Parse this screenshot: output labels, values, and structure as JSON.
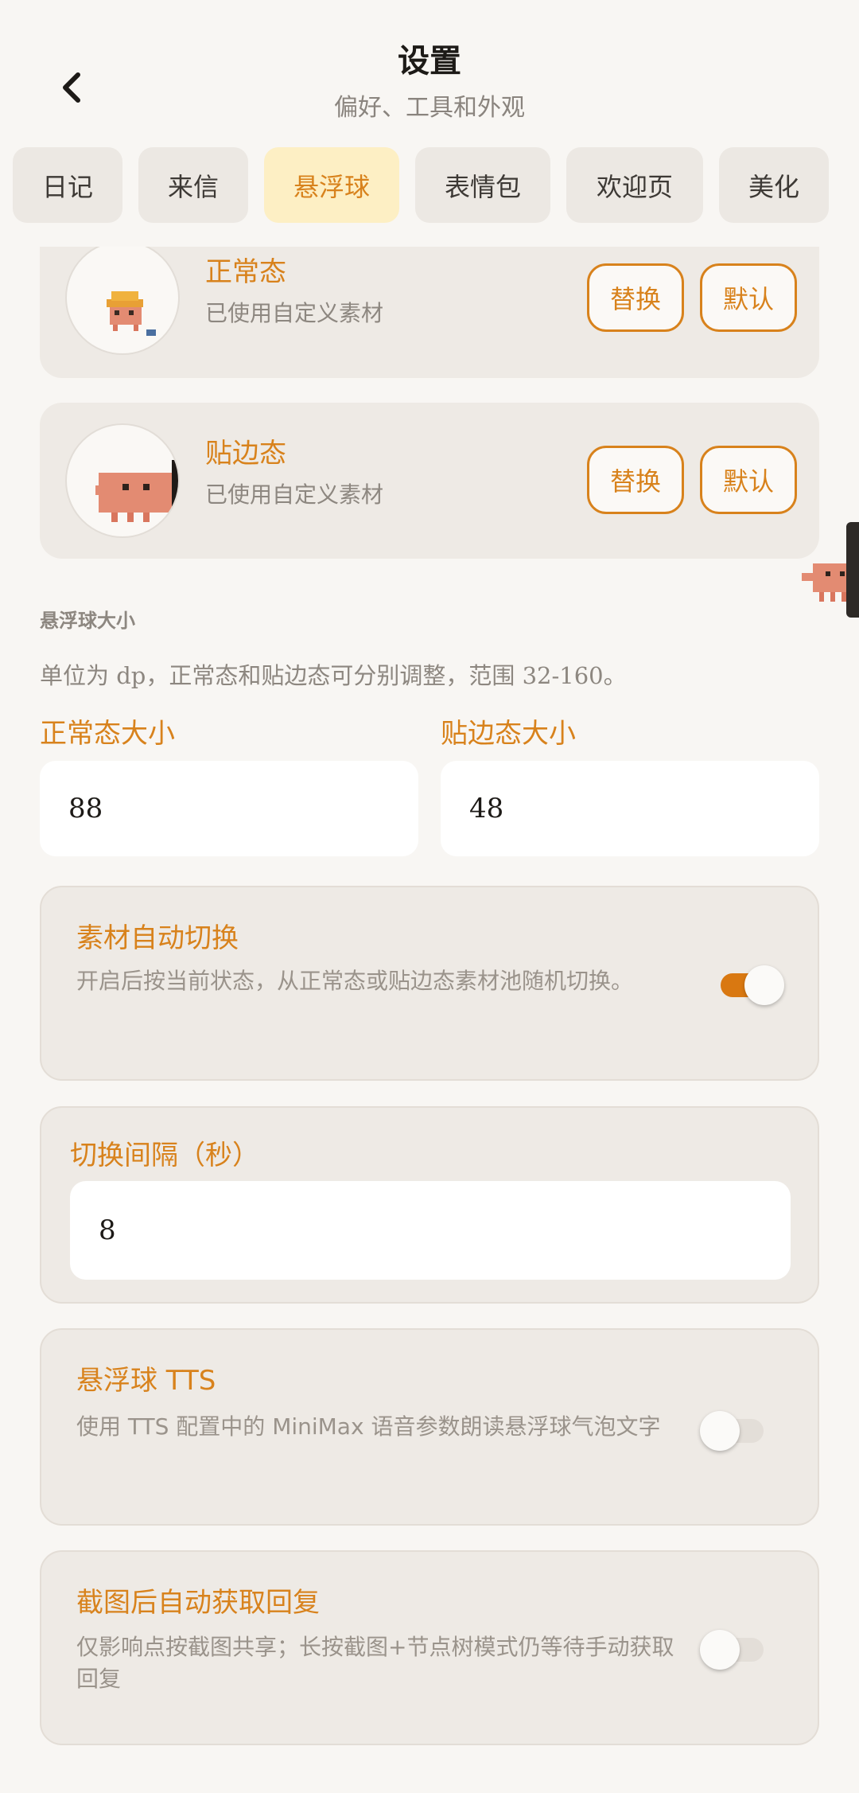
{
  "header": {
    "title": "设置",
    "subtitle": "偏好、工具和外观"
  },
  "tabs": [
    {
      "label": "日记"
    },
    {
      "label": "来信"
    },
    {
      "label": "悬浮球",
      "active": true
    },
    {
      "label": "表情包"
    },
    {
      "label": "欢迎页"
    },
    {
      "label": "美化"
    }
  ],
  "assets": {
    "normal": {
      "title": "正常态",
      "status": "已使用自定义素材",
      "replace_label": "替换",
      "default_label": "默认"
    },
    "edge": {
      "title": "贴边态",
      "status": "已使用自定义素材",
      "replace_label": "替换",
      "default_label": "默认"
    }
  },
  "size_section": {
    "title": "悬浮球大小",
    "desc": "单位为 dp，正常态和贴边态可分别调整，范围 32-160。",
    "normal_label": "正常态大小",
    "normal_value": "88",
    "edge_label": "贴边态大小",
    "edge_value": "48"
  },
  "auto_switch": {
    "title": "素材自动切换",
    "desc": "开启后按当前状态，从正常态或贴边态素材池随机切换。",
    "enabled": true
  },
  "interval": {
    "label": "切换间隔（秒）",
    "value": "8"
  },
  "tts": {
    "title": "悬浮球 TTS",
    "desc": "使用 TTS 配置中的 MiniMax 语音参数朗读悬浮球气泡文字",
    "enabled": false
  },
  "auto_reply": {
    "title": "截图后自动获取回复",
    "desc": "仅影响点按截图共享；长按截图+节点树模式仍等待手动获取回复",
    "enabled": false
  },
  "colors": {
    "accent": "#d8821c",
    "background": "#f8f6f3",
    "card": "#eeeae5",
    "active_tab": "#fdefc4"
  }
}
